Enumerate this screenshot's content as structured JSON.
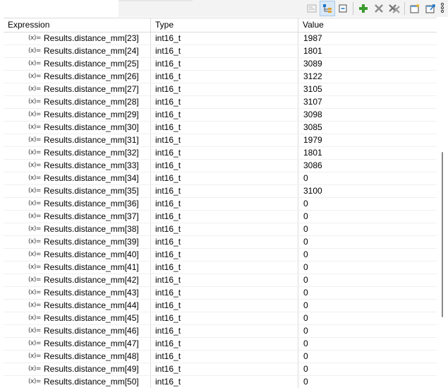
{
  "table": {
    "headers": {
      "expression": "Expression",
      "type": "Type",
      "value": "Value"
    },
    "rows": [
      {
        "icon": "(x)=",
        "expression": "Results.distance_mm[23]",
        "type": "int16_t",
        "value": "1987"
      },
      {
        "icon": "(x)=",
        "expression": "Results.distance_mm[24]",
        "type": "int16_t",
        "value": "1801"
      },
      {
        "icon": "(x)=",
        "expression": "Results.distance_mm[25]",
        "type": "int16_t",
        "value": "3089"
      },
      {
        "icon": "(x)=",
        "expression": "Results.distance_mm[26]",
        "type": "int16_t",
        "value": "3122"
      },
      {
        "icon": "(x)=",
        "expression": "Results.distance_mm[27]",
        "type": "int16_t",
        "value": "3105"
      },
      {
        "icon": "(x)=",
        "expression": "Results.distance_mm[28]",
        "type": "int16_t",
        "value": "3107"
      },
      {
        "icon": "(x)=",
        "expression": "Results.distance_mm[29]",
        "type": "int16_t",
        "value": "3098"
      },
      {
        "icon": "(x)=",
        "expression": "Results.distance_mm[30]",
        "type": "int16_t",
        "value": "3085"
      },
      {
        "icon": "(x)=",
        "expression": "Results.distance_mm[31]",
        "type": "int16_t",
        "value": "1979"
      },
      {
        "icon": "(x)=",
        "expression": "Results.distance_mm[32]",
        "type": "int16_t",
        "value": "1801"
      },
      {
        "icon": "(x)=",
        "expression": "Results.distance_mm[33]",
        "type": "int16_t",
        "value": "3086"
      },
      {
        "icon": "(x)=",
        "expression": "Results.distance_mm[34]",
        "type": "int16_t",
        "value": "0"
      },
      {
        "icon": "(x)=",
        "expression": "Results.distance_mm[35]",
        "type": "int16_t",
        "value": "3100"
      },
      {
        "icon": "(x)=",
        "expression": "Results.distance_mm[36]",
        "type": "int16_t",
        "value": "0"
      },
      {
        "icon": "(x)=",
        "expression": "Results.distance_mm[37]",
        "type": "int16_t",
        "value": "0"
      },
      {
        "icon": "(x)=",
        "expression": "Results.distance_mm[38]",
        "type": "int16_t",
        "value": "0"
      },
      {
        "icon": "(x)=",
        "expression": "Results.distance_mm[39]",
        "type": "int16_t",
        "value": "0"
      },
      {
        "icon": "(x)=",
        "expression": "Results.distance_mm[40]",
        "type": "int16_t",
        "value": "0"
      },
      {
        "icon": "(x)=",
        "expression": "Results.distance_mm[41]",
        "type": "int16_t",
        "value": "0"
      },
      {
        "icon": "(x)=",
        "expression": "Results.distance_mm[42]",
        "type": "int16_t",
        "value": "0"
      },
      {
        "icon": "(x)=",
        "expression": "Results.distance_mm[43]",
        "type": "int16_t",
        "value": "0"
      },
      {
        "icon": "(x)=",
        "expression": "Results.distance_mm[44]",
        "type": "int16_t",
        "value": "0"
      },
      {
        "icon": "(x)=",
        "expression": "Results.distance_mm[45]",
        "type": "int16_t",
        "value": "0"
      },
      {
        "icon": "(x)=",
        "expression": "Results.distance_mm[46]",
        "type": "int16_t",
        "value": "0"
      },
      {
        "icon": "(x)=",
        "expression": "Results.distance_mm[47]",
        "type": "int16_t",
        "value": "0"
      },
      {
        "icon": "(x)=",
        "expression": "Results.distance_mm[48]",
        "type": "int16_t",
        "value": "0"
      },
      {
        "icon": "(x)=",
        "expression": "Results.distance_mm[49]",
        "type": "int16_t",
        "value": "0"
      },
      {
        "icon": "(x)=",
        "expression": "Results.distance_mm[50]",
        "type": "int16_t",
        "value": "0"
      }
    ]
  },
  "toolbar": {
    "icons": [
      "show-type-names-icon",
      "show-logical-structure-icon",
      "collapse-all-icon",
      "add-expression-icon",
      "remove-expression-icon",
      "remove-all-expressions-icon",
      "new-view-icon",
      "export-icon",
      "view-menu-icon"
    ],
    "colors": {
      "add": "#3a9a2e",
      "remove": "#8c8c8c",
      "accent": "#1a73c9"
    }
  },
  "scroll": {
    "position_fraction": 0.36,
    "visible_fraction": 0.45
  }
}
